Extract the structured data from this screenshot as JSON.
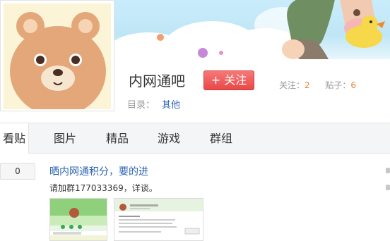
{
  "forum": {
    "name": "内网通吧",
    "follow_label": "+ 关注",
    "follow_label_key": "关注：",
    "follow_count": "2",
    "posts_label_key": "贴子：",
    "posts_count": "6",
    "catalog_label": "目录：",
    "catalog_value": "其他"
  },
  "tabs": [
    {
      "label": "看贴"
    },
    {
      "label": "图片"
    },
    {
      "label": "精品"
    },
    {
      "label": "游戏"
    },
    {
      "label": "群组"
    }
  ],
  "thread": {
    "reply_count": "0",
    "title": "晒内网通积分，要的进",
    "abstract": "请加群177033369，详谈。"
  },
  "colors": {
    "accent_red": "#e94848",
    "link_blue": "#2d64b3",
    "count_orange": "#e8813a"
  }
}
